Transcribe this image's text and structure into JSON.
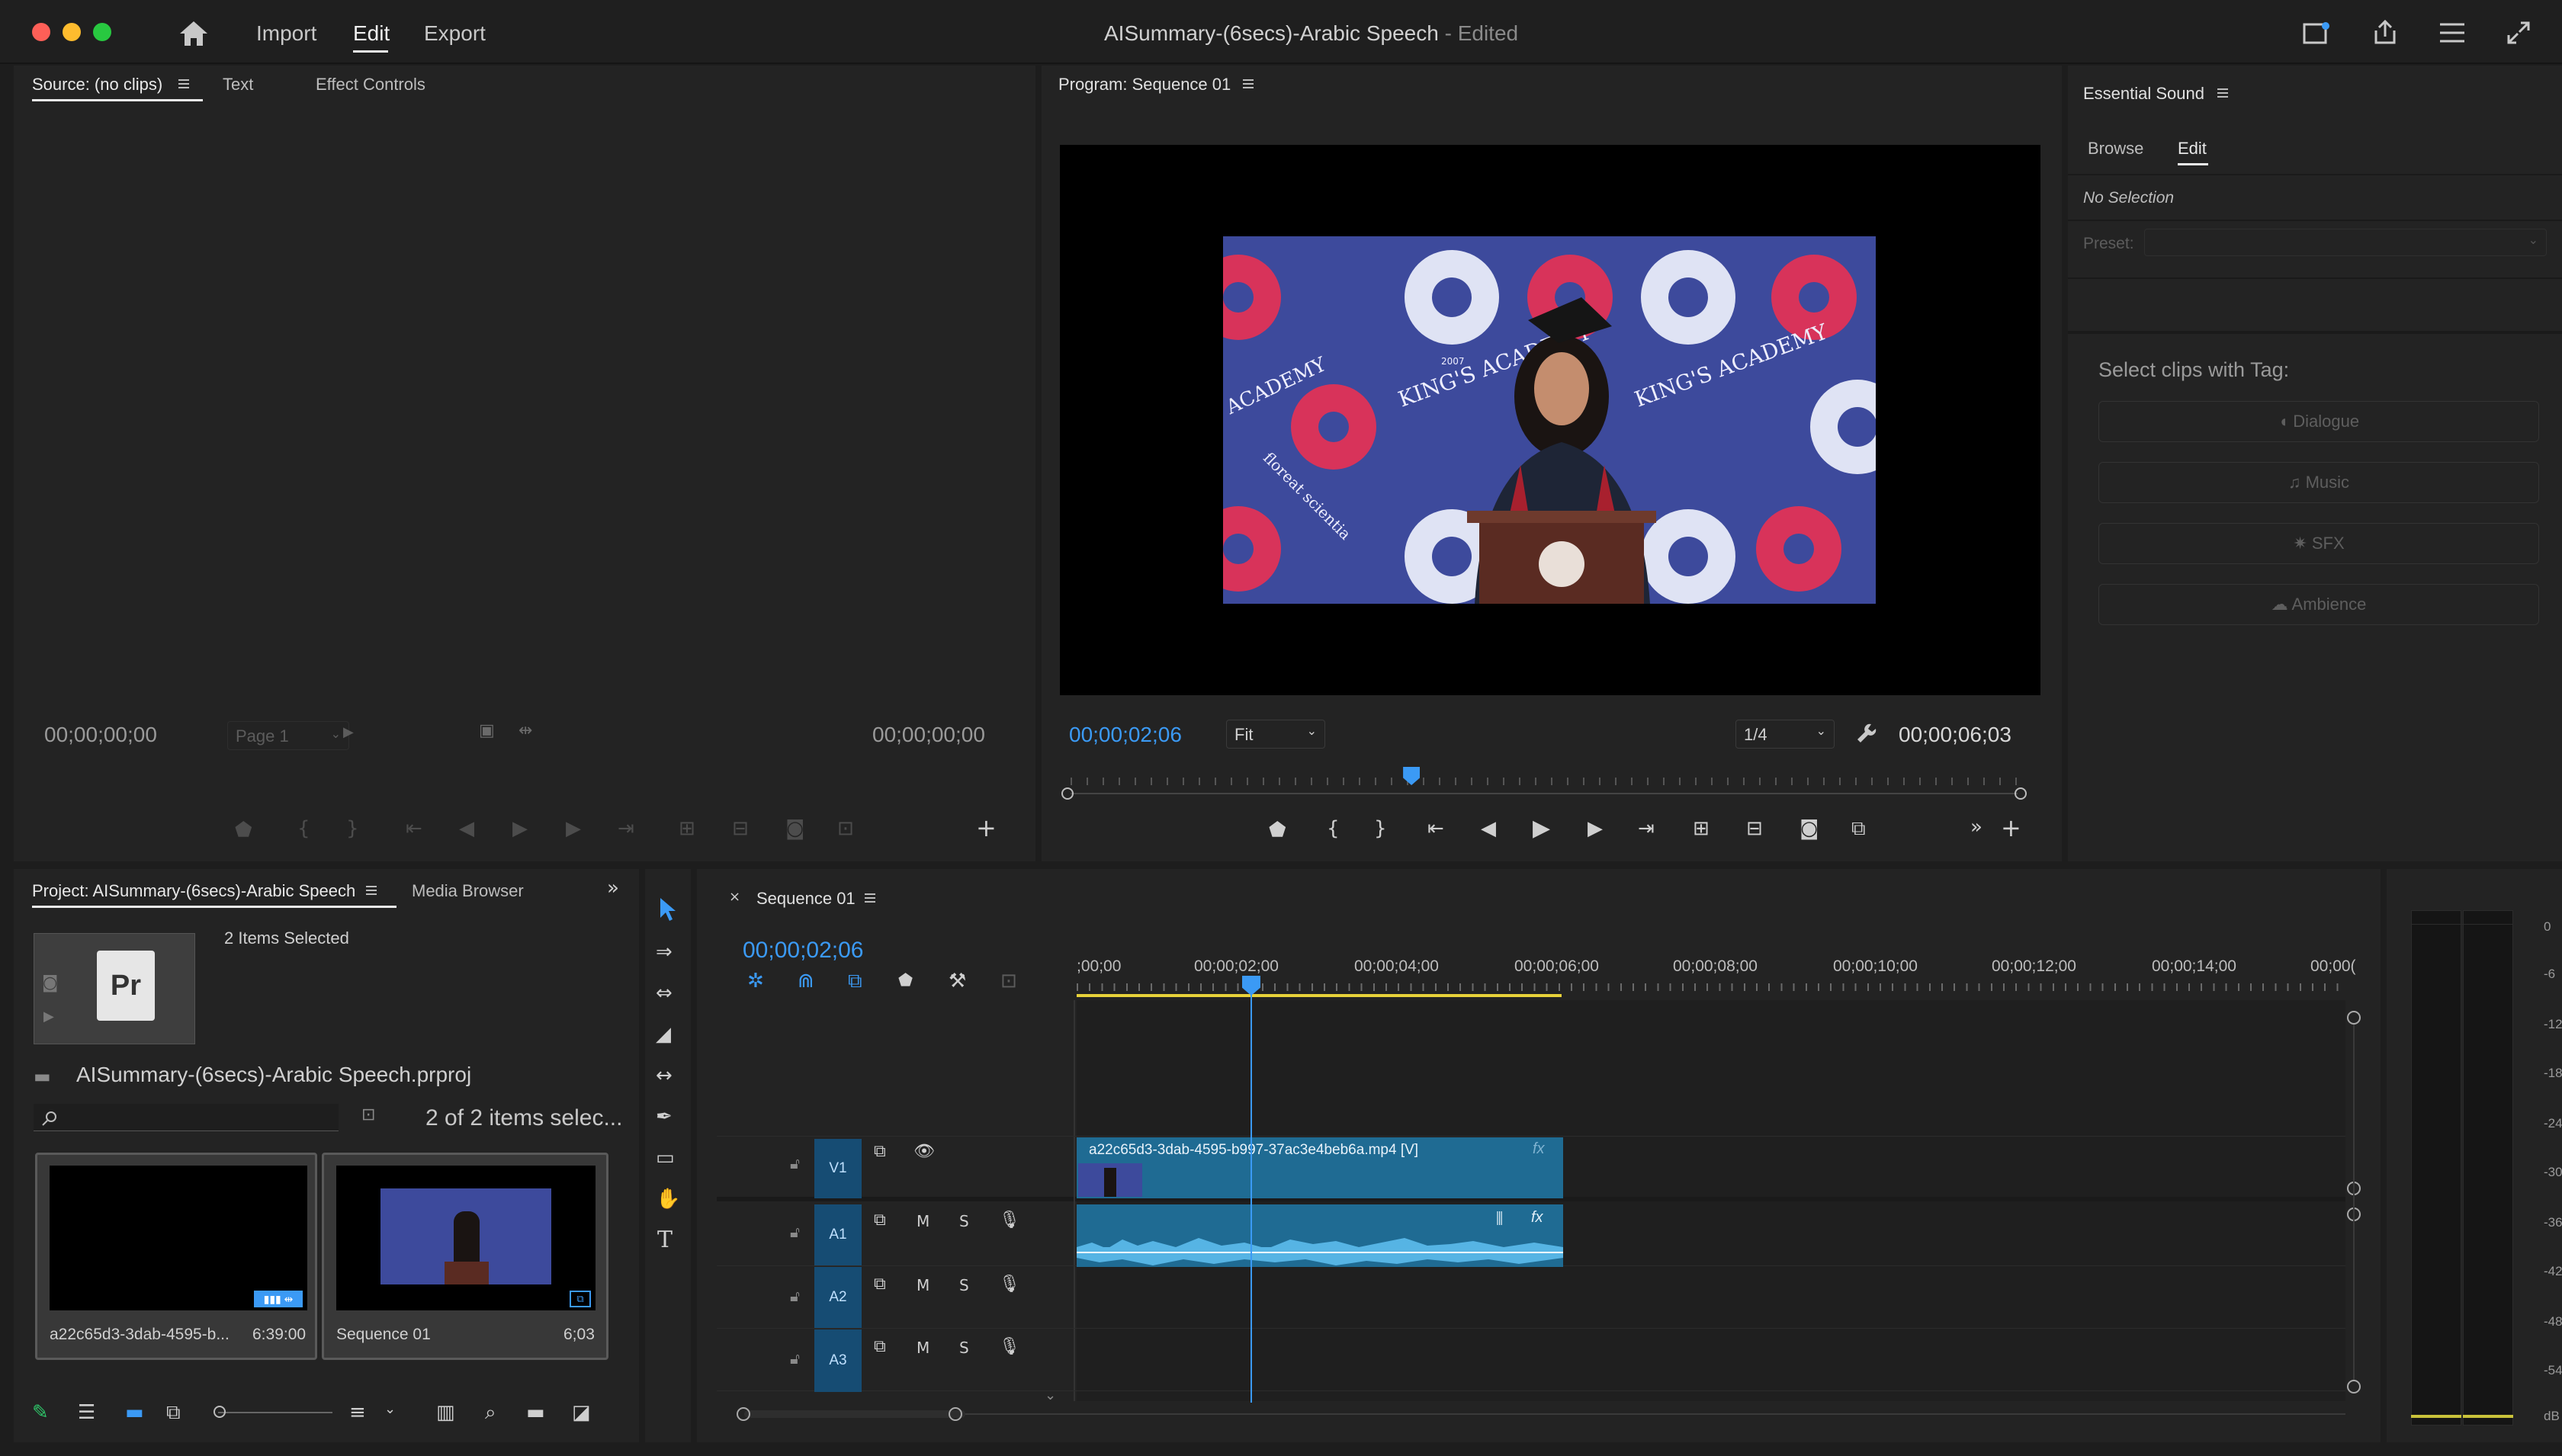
{
  "app": {
    "window_title": "AISummary-(6secs)-Arabic Speech",
    "edited_state": "- Edited"
  },
  "menu": {
    "import": "Import",
    "edit": "Edit",
    "export": "Export"
  },
  "source_panel": {
    "tabs": [
      {
        "label": "Source: (no clips)"
      },
      {
        "label": "Text"
      },
      {
        "label": "Effect Controls"
      }
    ],
    "timecode_in": "00;00;00;00",
    "timecode_out": "00;00;00;00",
    "page": "Page 1"
  },
  "program_panel": {
    "title": "Program: Sequence 01",
    "timecode": "00;00;02;06",
    "fit": "Fit",
    "resolution": "1/4",
    "duration": "00;00;06;03",
    "playhead_fraction": 0.36
  },
  "video_frame": {
    "backdrop_text_1": "KING'S ACADEMY",
    "backdrop_text_2": "KING'S ACADEMY",
    "backdrop_text_3": "ACADEMY",
    "backdrop_text_4": "floreat scientia",
    "year": "2007",
    "colors": {
      "backdrop": "#3d4a9c",
      "accent": "#d8335a"
    }
  },
  "essential_sound": {
    "title": "Essential Sound",
    "tabs": [
      {
        "label": "Browse"
      },
      {
        "label": "Edit"
      }
    ],
    "no_selection": "No Selection",
    "preset_label": "Preset:",
    "select_clips_label": "Select clips with Tag:",
    "buttons": [
      {
        "label": "Dialogue"
      },
      {
        "label": "Music"
      },
      {
        "label": "SFX"
      },
      {
        "label": "Ambience"
      }
    ]
  },
  "project_panel": {
    "tabs": [
      {
        "label": "Project: AISummary-(6secs)-Arabic Speech"
      },
      {
        "label": "Media Browser"
      }
    ],
    "selection_info": "2 Items Selected",
    "project_file": "AISummary-(6secs)-Arabic Speech.prproj",
    "items_count": "2 of 2 items selec...",
    "search_placeholder": "",
    "items": [
      {
        "name": "a22c65d3-3dab-4595-b...",
        "duration": "6:39:00"
      },
      {
        "name": "Sequence 01",
        "duration": "6;03"
      }
    ]
  },
  "timeline": {
    "sequence_tab": "Sequence 01",
    "timecode": "00;00;02;06",
    "ruler_labels": [
      ";00;00",
      "00;00;02;00",
      "00;00;04;00",
      "00;00;06;00",
      "00;00;08;00",
      "00;00;10;00",
      "00;00;12;00",
      "00;00;14;00",
      "00;00("
    ],
    "tracks": {
      "v1": "V1",
      "a1": "A1",
      "a2": "A2",
      "a3": "A3",
      "mute": "M",
      "solo": "S"
    },
    "video_clip_name": "a22c65d3-3dab-4595-b997-37ac3e4beb6a.mp4 [V]",
    "fx": "fx"
  },
  "vu_meter": {
    "labels": [
      "0",
      "-6",
      "-12",
      "-18",
      "-24",
      "-30",
      "-36",
      "-42",
      "-48",
      "-54",
      "dB"
    ]
  },
  "icons": [
    "home-icon",
    "panel-icon",
    "share-icon",
    "menu-lines-icon",
    "fullscreen-icon",
    "selection-tool-icon",
    "track-select-icon",
    "ripple-icon",
    "razor-icon",
    "slip-icon",
    "pen-icon",
    "rectangle-icon",
    "hand-icon",
    "type-icon",
    "wrench-icon",
    "play-icon",
    "marker-icon"
  ]
}
